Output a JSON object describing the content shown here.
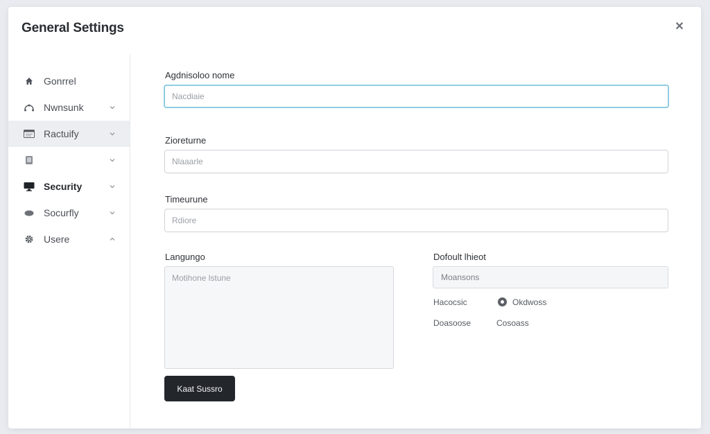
{
  "dialog": {
    "title": "General Settings",
    "close_icon": "close-icon"
  },
  "sidebar": {
    "items": [
      {
        "label": "Gonrrel",
        "icon": "home-icon",
        "chevron": "",
        "active": false,
        "bold": false
      },
      {
        "label": "Nwnsunk",
        "icon": "network-icon",
        "chevron": "down",
        "active": false,
        "bold": false
      },
      {
        "label": "Ractuify",
        "icon": "window-icon",
        "chevron": "down",
        "active": true,
        "bold": false
      },
      {
        "label": "",
        "icon": "device-icon",
        "chevron": "down",
        "active": false,
        "bold": false
      },
      {
        "label": "Security",
        "icon": "monitor-icon",
        "chevron": "down",
        "active": false,
        "bold": true
      },
      {
        "label": "Socurfly",
        "icon": "cloud-icon",
        "chevron": "down",
        "active": false,
        "bold": false
      },
      {
        "label": "Usere",
        "icon": "gear-icon",
        "chevron": "up",
        "active": false,
        "bold": false
      }
    ]
  },
  "form": {
    "app_name": {
      "label": "Agdnisoloo nome",
      "placeholder": "Nacdiaie"
    },
    "zone_name": {
      "label": "Zioreturne",
      "placeholder": "Nlaaarle"
    },
    "timezone": {
      "label": "Timeurune",
      "placeholder": "Rdiore"
    },
    "language": {
      "label": "Langungo",
      "placeholder": "Motihone lstune"
    },
    "default_list": {
      "label": "Dofoult lhieot",
      "select_value": "Moansons",
      "options": [
        {
          "label": "Hacocsic"
        },
        {
          "label": "Okdwoss",
          "selected": true
        },
        {
          "label": "Doasoose"
        },
        {
          "label": "Cosoass"
        }
      ]
    },
    "save_button": "Kaat Sussro"
  },
  "colors": {
    "focus_border": "#8fcde0",
    "button_bg": "#23272c",
    "active_row_bg": "#eceef2"
  }
}
